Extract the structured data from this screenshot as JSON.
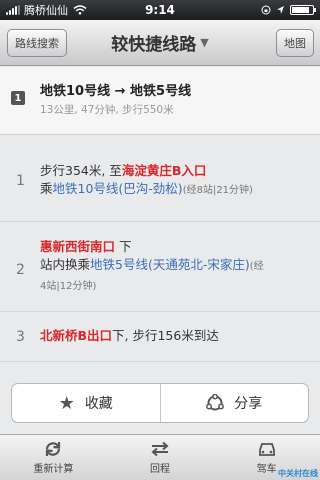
{
  "status_bar": {
    "carrier": "腾桥仙仙",
    "time": "9:14"
  },
  "nav": {
    "left_button": "路线搜索",
    "title": "较快捷线路",
    "title_caret": "▼",
    "right_button": "地图"
  },
  "summary": {
    "index": "1",
    "route": "地铁10号线 → 地铁5号线",
    "info": "13公里, 47分钟, 步行550米"
  },
  "steps": [
    {
      "num": "1",
      "line1_pre": "步行354米, 至",
      "line1_place": "海淀黄庄B入口",
      "line2_pre": "乘",
      "line2_line": "地铁10号线(巴沟-劲松)",
      "line2_detail": "(经8站|21分钟)"
    },
    {
      "num": "2",
      "line1_place": "惠新西街南口",
      "line1_post": " 下",
      "line2_pre": "站内换乘",
      "line2_line": "地铁5号线(天通苑北-宋家庄)",
      "line2_detail_a": "(经",
      "line2_detail_b": "4站|12分钟)"
    },
    {
      "num": "3",
      "line1_place": "北新桥B出口",
      "line1_post": "下, 步行156米到达"
    }
  ],
  "actions": {
    "favorite": "收藏",
    "share": "分享"
  },
  "tabs": {
    "recalc": "重新计算",
    "return": "回程",
    "drive": "驾车"
  },
  "watermark": "中关村在线"
}
